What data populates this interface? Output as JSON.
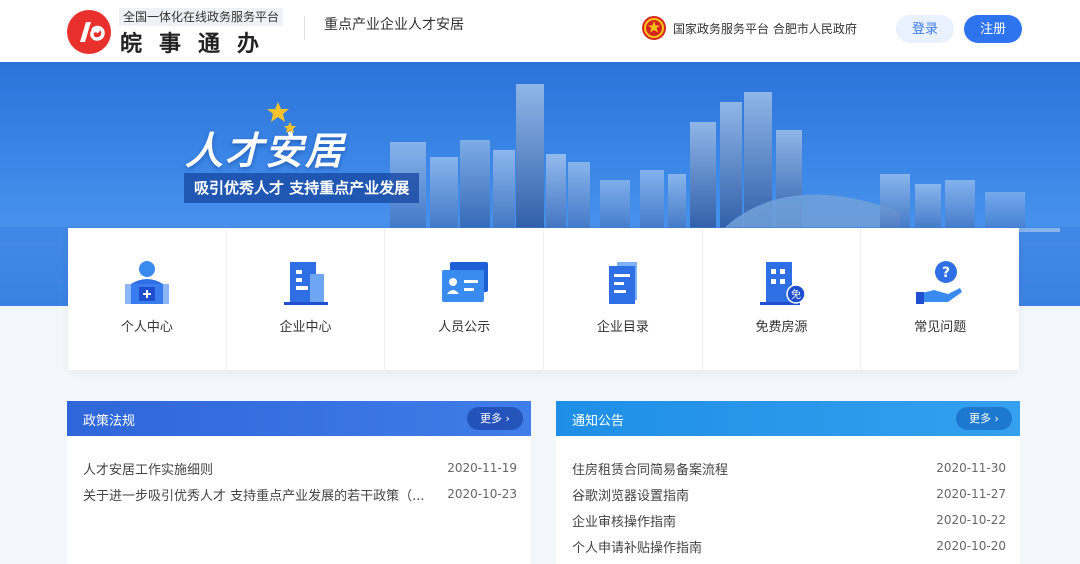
{
  "header": {
    "platform_sub": "全国一体化在线政务服务平台",
    "platform_name": "皖事通办",
    "site_title": "重点产业企业人才安居",
    "gov_links": "国家政务服务平台 合肥市人民政府",
    "login_label": "登录",
    "register_label": "注册"
  },
  "banner": {
    "title": "人才安居",
    "slogan": "吸引优秀人才  支持重点产业发展"
  },
  "quicknav": [
    {
      "label": "个人中心",
      "icon": "personal-center-icon"
    },
    {
      "label": "企业中心",
      "icon": "enterprise-center-icon"
    },
    {
      "label": "人员公示",
      "icon": "personnel-notice-icon"
    },
    {
      "label": "企业目录",
      "icon": "enterprise-directory-icon"
    },
    {
      "label": "免费房源",
      "icon": "free-housing-icon"
    },
    {
      "label": "常见问题",
      "icon": "faq-icon"
    }
  ],
  "policy": {
    "title": "政策法规",
    "more_label": "更多 ›",
    "items": [
      {
        "title": "人才安居工作实施细则",
        "date": "2020-11-19"
      },
      {
        "title": "关于进一步吸引优秀人才 支持重点产业发展的若干政策（...",
        "date": "2020-10-23"
      }
    ]
  },
  "notice": {
    "title": "通知公告",
    "more_label": "更多 ›",
    "items": [
      {
        "title": "住房租赁合同简易备案流程",
        "date": "2020-11-30"
      },
      {
        "title": "谷歌浏览器设置指南",
        "date": "2020-11-27"
      },
      {
        "title": "企业审核操作指南",
        "date": "2020-10-22"
      },
      {
        "title": "个人申请补贴操作指南",
        "date": "2020-10-20"
      }
    ]
  },
  "colors": {
    "primary": "#2f74ef",
    "banner": "#3b86e6",
    "policy_head": "#2f66d9",
    "notice_head": "#1e8fe6",
    "logo_red": "#e8312c"
  }
}
